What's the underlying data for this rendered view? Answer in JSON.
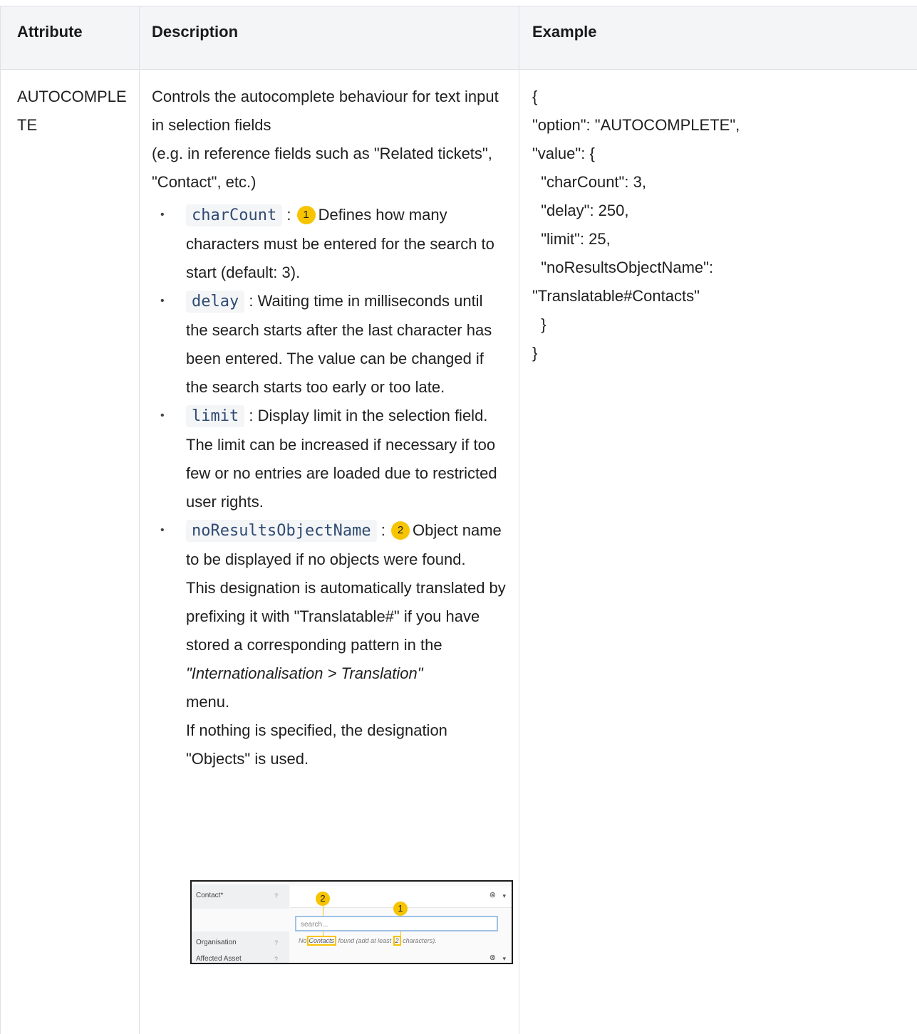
{
  "table": {
    "headers": {
      "attribute": "Attribute",
      "description": "Description",
      "example": "Example"
    },
    "row": {
      "attribute": "AUTOCOMPLETE",
      "intro": "Controls the autocomplete behaviour for text input in selection fields",
      "intro2": "(e.g. in reference fields such as \"Related tickets\", \"Contact\", etc.)",
      "options": [
        {
          "code": "charCount",
          "sep": ":",
          "badge": "1",
          "text": "Defines how many characters must be entered for the search to start (default: 3)."
        },
        {
          "code": "delay",
          "sep": ":",
          "text": "Waiting time in milliseconds until the search starts after the last character has been entered. The value can be changed if the search starts too early or too late."
        },
        {
          "code": "limit",
          "sep": ":",
          "text": "Display limit in the selection field. The limit can be increased if necessary if too few or no entries are loaded due to restricted user rights."
        },
        {
          "code": "noResultsObjectName",
          "sep": ":",
          "badge": "2",
          "text": "Object name to be displayed if no objects were found."
        }
      ],
      "translate_text": "This designation is automatically translated by prefixing it with \"Translatable#\" if you have stored a corresponding pattern in the",
      "menu_path": "\"Internationalisation > Translation\"",
      "menu_word": "menu.",
      "default_text": "If nothing is specified, the designation \"Objects\" is used.",
      "example_code": "{\n\"option\": \"AUTOCOMPLETE\",\n\"value\": {\n  \"charCount\": 3,\n  \"delay\": 250,\n  \"limit\": 25,\n  \"noResultsObjectName\":\n\"Translatable#Contacts\"\n  }\n}"
    }
  },
  "screenshot": {
    "contact_label": "Contact*",
    "organisation_label": "Organisation",
    "asset_label": "Affected Asset",
    "search_placeholder": "search...",
    "msg_before": "No",
    "msg_obj": "Contacts",
    "msg_mid": "found (add at least",
    "msg_num": "2",
    "msg_after": "characters).",
    "marker_1": "1",
    "marker_2": "2",
    "help_icon": "?",
    "clear_icon": "⊗",
    "caret_icon": "▾"
  }
}
